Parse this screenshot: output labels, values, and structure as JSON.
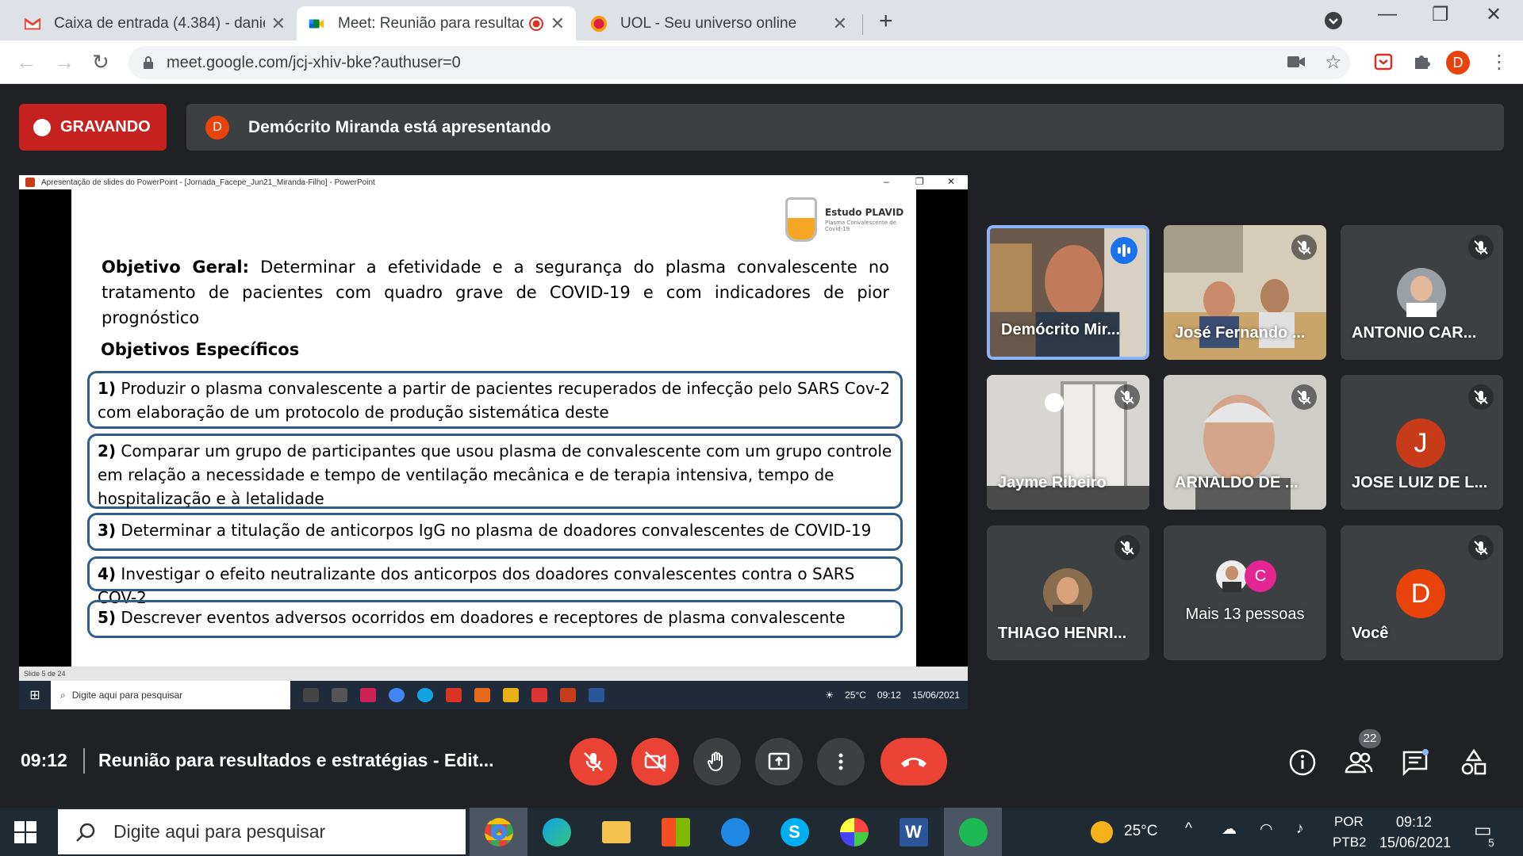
{
  "browser": {
    "tabs": [
      {
        "title": "Caixa de entrada (4.384) - daniel",
        "active": false
      },
      {
        "title": "Meet: Reunião para resultad",
        "active": true
      },
      {
        "title": "UOL - Seu universo online",
        "active": false
      }
    ],
    "url": "meet.google.com/jcj-xhiv-bke?authuser=0",
    "profile_initial": "D"
  },
  "meet": {
    "recording_label": "GRAVANDO",
    "presenter_initial": "D",
    "presenting_text": "Demócrito Miranda está apresentando",
    "time": "09:12",
    "meeting_name": "Reunião para resultados e estratégias - Edit...",
    "participants_count": "22",
    "accent_red": "#ea4335",
    "speaking_border": "#8ab4f8"
  },
  "presentation": {
    "window_title": "Apresentação de slides do PowerPoint - [Jornada_Facepe_Jun21_Miranda-Filho] - PowerPoint",
    "logo_name": "Estudo PLAVID",
    "logo_sub": "Plasma Convalescente de Covid-19",
    "objetivo_geral_label": "Objetivo Geral:",
    "objetivo_geral_text": " Determinar a efetividade e a segurança do plasma convalescente no tratamento de pacientes com quadro grave de COVID-19 e com indicadores de pior prognóstico",
    "objetivos_especificos_label": "Objetivos Específicos",
    "objetivos": [
      {
        "num": "1)",
        "text": " Produzir o plasma convalescente a partir de pacientes recuperados de infecção pelo SARS Cov-2 com elaboração de um protocolo de produção sistemática deste"
      },
      {
        "num": "2)",
        "text": " Comparar um grupo  de participantes que usou plasma  de convalescente com um grupo controle em relação a necessidade e tempo de ventilação mecânica  e de terapia intensiva, tempo de hospitalização e à letalidade"
      },
      {
        "num": "3)",
        "text": " Determinar a titulação de anticorpos IgG no plasma de doadores convalescentes de COVID-19"
      },
      {
        "num": "4)",
        "text": " Investigar o efeito neutralizante dos anticorpos dos doadores convalescentes contra o SARS COV-2"
      },
      {
        "num": "5)",
        "text": " Descrever eventos adversos ocorridos em doadores e receptores de plasma convalescente"
      }
    ],
    "status": "Slide 5 de 24",
    "inner_search": "Digite aqui para pesquisar",
    "inner_temp": "25°C",
    "inner_time": "09:12",
    "inner_date": "15/06/2021"
  },
  "participants": [
    {
      "name": "Demócrito Mir...",
      "speaking": true,
      "kind": "video"
    },
    {
      "name": "José Fernando ...",
      "muted": true,
      "kind": "video"
    },
    {
      "name": "ANTONIO CAR...",
      "muted": true,
      "kind": "photo"
    },
    {
      "name": "Jayme Ribeiro",
      "muted": true,
      "kind": "video"
    },
    {
      "name": "ARNALDO DE ...",
      "muted": true,
      "kind": "video"
    },
    {
      "name": "JOSE LUIZ DE L...",
      "muted": true,
      "kind": "initial",
      "initial": "J",
      "color": "#c83b18"
    },
    {
      "name": "THIAGO HENRI...",
      "muted": true,
      "kind": "photo"
    },
    {
      "name": "Mais 13 pessoas",
      "kind": "more",
      "initial": "C",
      "color": "#e52592"
    },
    {
      "name": "Você",
      "muted": true,
      "kind": "initial",
      "initial": "D",
      "color": "#e8430a"
    }
  ],
  "taskbar": {
    "search_placeholder": "Digite aqui para pesquisar",
    "temperature": "25°C",
    "language": "POR",
    "layout": "PTB2",
    "time": "09:12",
    "date": "15/06/2021",
    "notifications": "5"
  }
}
